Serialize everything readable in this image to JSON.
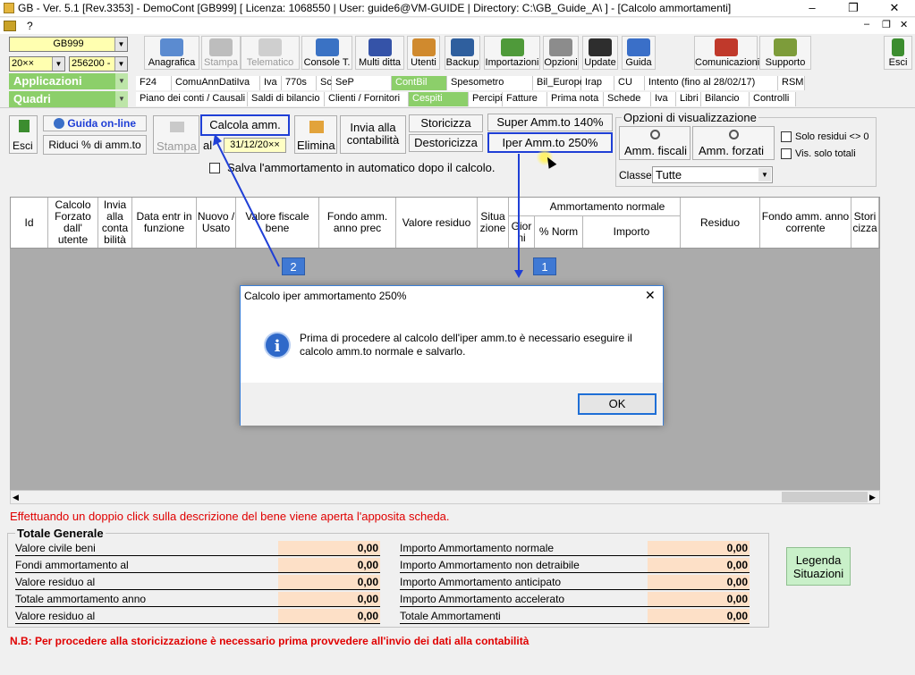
{
  "window": {
    "title": "GB - Ver. 5.1 [Rev.3353] -  DemoCont [GB999]     [ Licenza: 1068550 | User: guide6@VM-GUIDE | Directory: C:\\GB_Guide_A\\ ] - [Calcolo ammortamenti]",
    "min": "–",
    "max": "❐",
    "close": "✕",
    "menu_help": "?",
    "mdi_min": "–",
    "mdi_max": "❐",
    "mdi_close": "✕"
  },
  "selectors": {
    "company": "GB999",
    "year": "20××",
    "code": "256200 -",
    "applicazioni": "Applicazioni",
    "quadri": "Quadri",
    "arrow": "▼"
  },
  "toolbar": [
    {
      "label": "Anagrafica",
      "icon": "book-icon",
      "color": "#5b8bd0"
    },
    {
      "label": "Stampa",
      "icon": "printer-icon",
      "color": "#bdbdbd",
      "disabled": true
    },
    {
      "label": "Telematico",
      "icon": "telematico-icon",
      "color": "#cfcfcf",
      "disabled": true
    },
    {
      "label": "Console T.",
      "icon": "console-icon",
      "color": "#3a72c4"
    },
    {
      "label": "Multi ditta",
      "icon": "multi-ditta-icon",
      "color": "#3553a8"
    },
    {
      "label": "Utenti",
      "icon": "users-icon",
      "color": "#d08a2e"
    },
    {
      "label": "Backup",
      "icon": "backup-icon",
      "color": "#2f5f9e"
    },
    {
      "label": "Importazioni",
      "icon": "import-icon",
      "color": "#4f9a3a"
    },
    {
      "label": "Opzioni",
      "icon": "wrench-icon",
      "color": "#8c8c8c"
    },
    {
      "label": "Update",
      "icon": "update-icon",
      "color": "#2e2e2e"
    },
    {
      "label": "Guida",
      "icon": "help-icon",
      "color": "#3a6fc8"
    },
    {
      "label": "Comunicazioni",
      "icon": "comunicazioni-icon",
      "color": "#c0392b"
    },
    {
      "label": "Supporto",
      "icon": "supporto-icon",
      "color": "#7d9c3a"
    }
  ],
  "exit_button": "Esci",
  "tabs_row1": [
    "F24",
    "ComuAnnDatiIva",
    "Iva",
    "770s",
    "Sc",
    "SeP",
    "ContBil",
    "Spesometro",
    "Bil_Europeo",
    "Irap",
    "CU",
    "Intento (fino al 28/02/17)",
    "RSM"
  ],
  "tabs_row2": [
    "Piano dei conti / Causali",
    "Saldi di bilancio",
    "Clienti / Fornitori",
    "Cespiti",
    "Percipienti",
    "Fatture",
    "Prima nota",
    "Schede",
    "Iva",
    "Libri",
    "Bilancio",
    "Controlli"
  ],
  "actions": {
    "esci": "Esci",
    "guida_online": "Guida on-line",
    "riduci": "Riduci % di amm.to",
    "stampa": "Stampa",
    "calcola": "Calcola amm.",
    "al": "al",
    "date": "31/12/20××",
    "elimina": "Elimina",
    "invia": "Invia alla contabilità",
    "storicizza": "Storicizza",
    "destoricizza": "Destoricizza",
    "super": "Super Amm.to 140%",
    "iper": "Iper Amm.to 250%",
    "salva": "Salva l'ammortamento in automatico dopo il calcolo."
  },
  "opzioni": {
    "title": "Opzioni di visualizzazione",
    "fiscali": "Amm. fiscali",
    "forzati": "Amm. forzati",
    "solo_residui": "Solo residui <> 0",
    "solo_totali": "Vis. solo totali",
    "classe_label": "Classe",
    "classe_value": "Tutte"
  },
  "grid": {
    "group_header": "Ammortamento normale",
    "columns": [
      "Id",
      "Calcolo Forzato dall' utente",
      "Invia alla conta bilità",
      "Data entr in funzione",
      "Nuovo / Usato",
      "Valore fiscale bene",
      "Fondo amm. anno prec",
      "Valore residuo",
      "Situa zione",
      "Gior ni",
      "% Norm",
      "Importo",
      "Residuo",
      "Fondo amm. anno corrente",
      "Stori cizza"
    ]
  },
  "double_click_msg": "Effettuando un doppio click sulla descrizione del bene viene aperta l'apposita scheda.",
  "totals": {
    "title": "Totale Generale",
    "left": [
      {
        "label": "Valore civile beni",
        "value": "0,00"
      },
      {
        "label": "Fondi ammortamento al",
        "value": "0,00"
      },
      {
        "label": "Valore residuo al",
        "value": "0,00"
      },
      {
        "label": "Totale ammortamento anno",
        "value": "0,00"
      },
      {
        "label": "Valore residuo al",
        "value": "0,00"
      }
    ],
    "right": [
      {
        "label": "Importo Ammortamento normale",
        "value": "0,00"
      },
      {
        "label": "Importo Ammortamento non detraibile",
        "value": "0,00"
      },
      {
        "label": "Importo Ammortamento anticipato",
        "value": "0,00"
      },
      {
        "label": "Importo Ammortamento accelerato",
        "value": "0,00"
      },
      {
        "label": "Totale Ammortamenti",
        "value": "0,00"
      }
    ]
  },
  "legenda": "Legenda Situazioni",
  "nb": "N.B: Per procedere alla storicizzazione è necessario prima provvedere all'invio dei dati alla contabilità",
  "dialog": {
    "title": "Calcolo iper ammortamento 250%",
    "message": "Prima di procedere al calcolo dell'iper amm.to è necessario eseguire il calcolo amm.to normale e salvarlo.",
    "ok": "OK",
    "close": "✕",
    "info": "i"
  },
  "annotations": {
    "badge1": "1",
    "badge2": "2"
  },
  "colors": {
    "accent_green": "#8ccf6a",
    "highlight_blue": "#1f3fd6",
    "badge_blue": "#3f79d4",
    "alert_red": "#e00000",
    "value_bg": "#fde0c7"
  }
}
